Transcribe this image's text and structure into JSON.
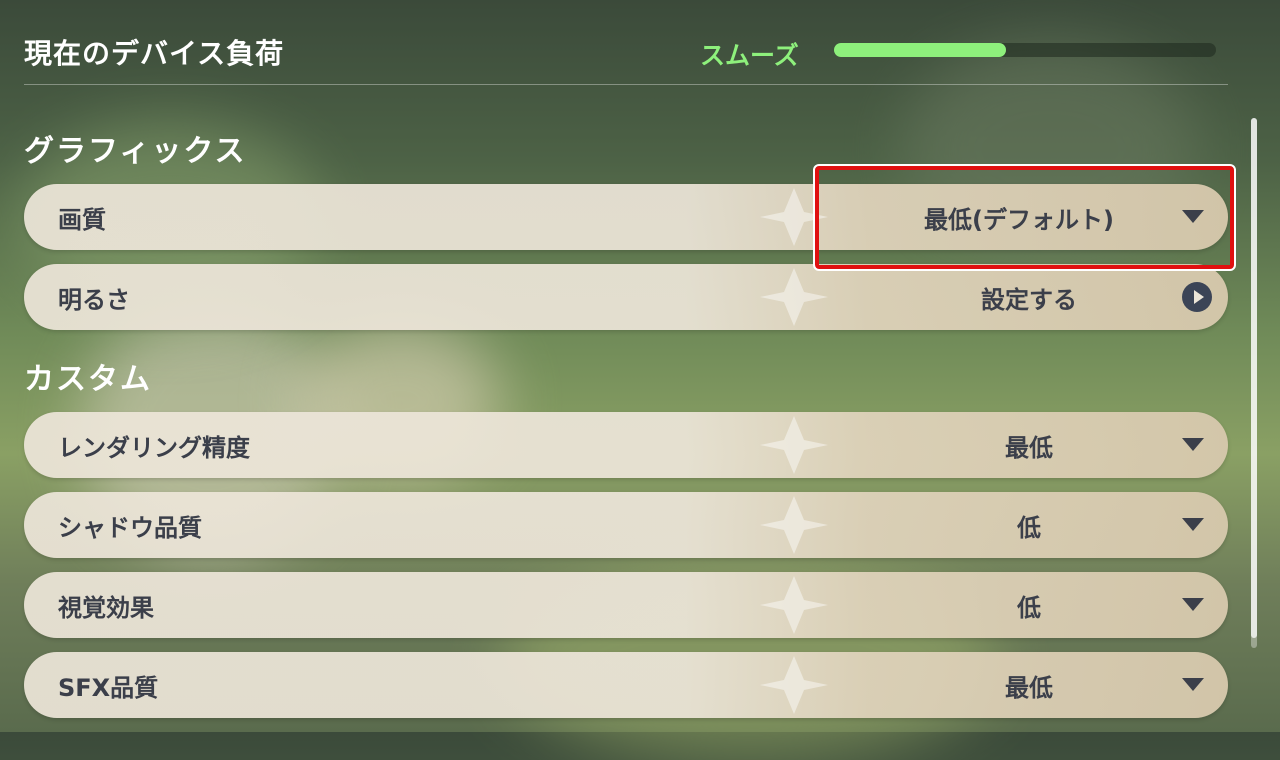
{
  "header": {
    "title": "現在のデバイス負荷",
    "load_status": "スムーズ",
    "load_level": 0.45,
    "load_color": "#8ef07c"
  },
  "sections": {
    "graphics": "グラフィックス",
    "custom": "カスタム"
  },
  "graphics_rows": [
    {
      "label": "画質",
      "value": "最低(デフォルト)",
      "control": "dropdown"
    },
    {
      "label": "明るさ",
      "value": "設定する",
      "control": "navigate"
    }
  ],
  "custom_rows": [
    {
      "label": "レンダリング精度",
      "value": "最低",
      "control": "dropdown"
    },
    {
      "label": "シャドウ品質",
      "value": "低",
      "control": "dropdown"
    },
    {
      "label": "視覚効果",
      "value": "低",
      "control": "dropdown"
    },
    {
      "label": "SFX品質",
      "value": "最低",
      "control": "dropdown"
    }
  ],
  "icons": {
    "dropdown": "chevron-down-icon",
    "navigate": "arrow-right-circle-icon"
  },
  "colors": {
    "row_bg": "#ece5d8",
    "text": "#3b3f4a",
    "highlight": "#e01010"
  }
}
